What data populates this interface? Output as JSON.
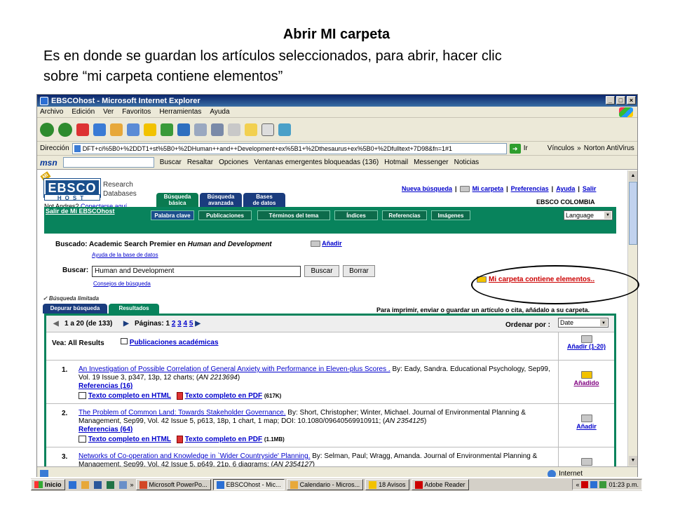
{
  "slide": {
    "title": "Abrir MI carpeta",
    "line1": "Es en donde se guardan los artículos seleccionados, para abrir, hacer clic",
    "line2": "sobre “mi carpeta contiene elementos”"
  },
  "browser": {
    "title": "EBSCOhost - Microsoft Internet Explorer",
    "menu": [
      "Archivo",
      "Edición",
      "Ver",
      "Favoritos",
      "Herramientas",
      "Ayuda"
    ],
    "address_label": "Dirección",
    "address_value": "DFT+ci%5B0+%2DDT1+st%5B0+%2DHuman++and++Development+ex%5B1+%2Dthesaurus+ex%5B0+%2Dfulltext+7D98&fn=1#1",
    "go_label": "Ir",
    "links_label": "Vínculos",
    "norton_label": "Norton AntiVirus",
    "msn_label": "msn",
    "msn_buttons": [
      "Buscar",
      "Resaltar",
      "Opciones",
      "Ventanas emergentes bloqueadas (136)",
      "Hotmail",
      "Messenger",
      "Noticias"
    ],
    "status_zone": "Internet"
  },
  "page": {
    "research_line1": "Research",
    "research_line2": "Databases",
    "logo_text": "EBSCO",
    "logo_host": "HOST",
    "logo_badge": "MI",
    "not_user": "Not Andres?",
    "connect_link": "Conectarse aquí",
    "top_nav": [
      "Nueva búsqueda",
      "Mi carpeta",
      "Preferencias",
      "Ayuda",
      "Salir"
    ],
    "search_tabs": [
      {
        "line1": "Búsqueda",
        "line2": "básica"
      },
      {
        "line1": "Búsqueda",
        "line2": "avanzada"
      },
      {
        "line1": "Bases",
        "line2": "de datos"
      }
    ],
    "ebsco_colombia": "EBSCO COLOMBIA",
    "salir_link": "Salir de Mi EBSCOhost",
    "sub_tabs": [
      "Palabra clave",
      "Publicaciones",
      "Términos del tema",
      "Índices",
      "Referencias",
      "Imágenes"
    ],
    "language": "Language",
    "buscado": "Buscado: Academic Search Premier en ",
    "buscado_topic": "Human and Development",
    "anadir": "Añadir",
    "ayuda_bd": "Ayuda de la base de datos",
    "buscar_label": "Buscar:",
    "search_value": "Human and Development",
    "buscar_btn": "Buscar",
    "borrar_btn": "Borrar",
    "consejos": "Consejos de búsqueda",
    "mi_carpeta_contiene": "Mi carpeta contiene elementos..",
    "busqueda_limitada": "✓ Búsqueda limitada",
    "result_tabs": [
      "Depurar búsqueda",
      "Resultados"
    ],
    "imprimir_text": "Para imprimir, enviar o guardar un artículo o cita, añádalo a su carpeta.",
    "range": "1 a 20",
    "total": "(de 133)",
    "paginas_label": "Páginas: 1",
    "pages": [
      "2",
      "3",
      "4",
      "5"
    ],
    "ordenar_label": "Ordenar por :",
    "ordenar_value": "Date",
    "vea_label": "Vea: All Results",
    "publicaciones_link": "Publicaciones académicas",
    "anadir_range": "Añadir (1-20)",
    "results": [
      {
        "num": "1.",
        "title": "An Investigation of Possible Correlation of General Anxiety with Performance in Eleven-plus Scores .",
        "cite": " By: Eady, Sandra. Educational Psychology, Sep99, Vol. 19 Issue 3, p347, 13p, 12 charts; (",
        "an": "AN 2213694",
        "refs": "Referencias (16)",
        "html": "Texto completo en HTML",
        "pdf": "Texto completo en PDF",
        "size": "(617K)",
        "action": "Añadido"
      },
      {
        "num": "2.",
        "title": "The Problem of Common Land: Towards Stakeholder Governance.",
        "cite": " By: Short, Christopher; Winter, Michael. Journal of Environmental Planning & Management, Sep99, Vol. 42 Issue 5, p613, 18p, 1 chart, 1 map; DOI: 10.1080/09640569910911; (",
        "an": "AN 2354125",
        "refs": "Referencias (64)",
        "html": "Texto completo en HTML",
        "pdf": "Texto completo en PDF",
        "size": "(1.1MB)",
        "action": "Añadir"
      },
      {
        "num": "3.",
        "title": "Networks of Co-operation and Knowledge in `Wider Countryside' Planning.",
        "cite": " By: Selman, Paul; Wragg, Amanda. Journal of Environmental Planning & Management, Sep99, Vol. 42 Issue 5, p649, 21p, 6 diagrams; (",
        "an": "AN 2354127",
        "refs": "",
        "html": "",
        "pdf": "",
        "size": "",
        "action": ""
      }
    ]
  },
  "taskbar": {
    "start": "Inicio",
    "tasks": [
      "Microsoft PowerPo...",
      "EBSCOhost - Mic...",
      "Calendario - Micros...",
      "18 Avisos",
      "Adobe Reader"
    ],
    "clock": "01:23 p.m."
  }
}
